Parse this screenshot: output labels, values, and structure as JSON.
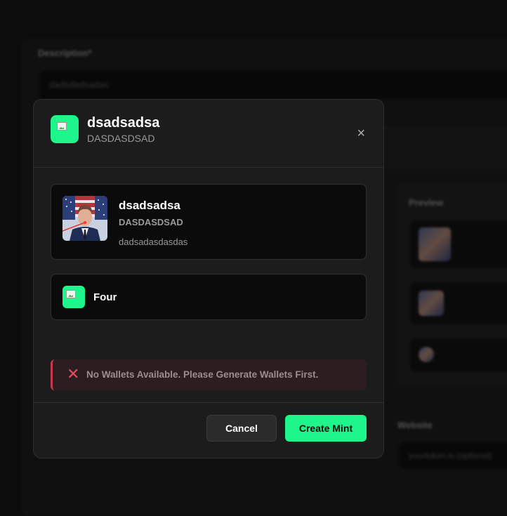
{
  "background": {
    "description_label": "Description*",
    "description_value": "dadsdadsadas",
    "preview_label": "Preview",
    "website_label": "Website",
    "website_placeholder": "yourtoken.io (optional)"
  },
  "modal": {
    "title": "dsadsadsa",
    "subtitle": "DASDASDSAD",
    "close_icon": "×",
    "token": {
      "name": "dsadsadsa",
      "symbol": "DASDASDSAD",
      "description": "dadsadasdasdas"
    },
    "platform": {
      "name": "Four"
    },
    "alert": {
      "icon": "✕",
      "message": "No Wallets Available. Please Generate Wallets First."
    },
    "buttons": {
      "cancel": "Cancel",
      "create": "Create Mint"
    }
  },
  "colors": {
    "accent": "#1ef58a",
    "error": "#ea4a63",
    "modal_bg": "#1c1c1c"
  }
}
